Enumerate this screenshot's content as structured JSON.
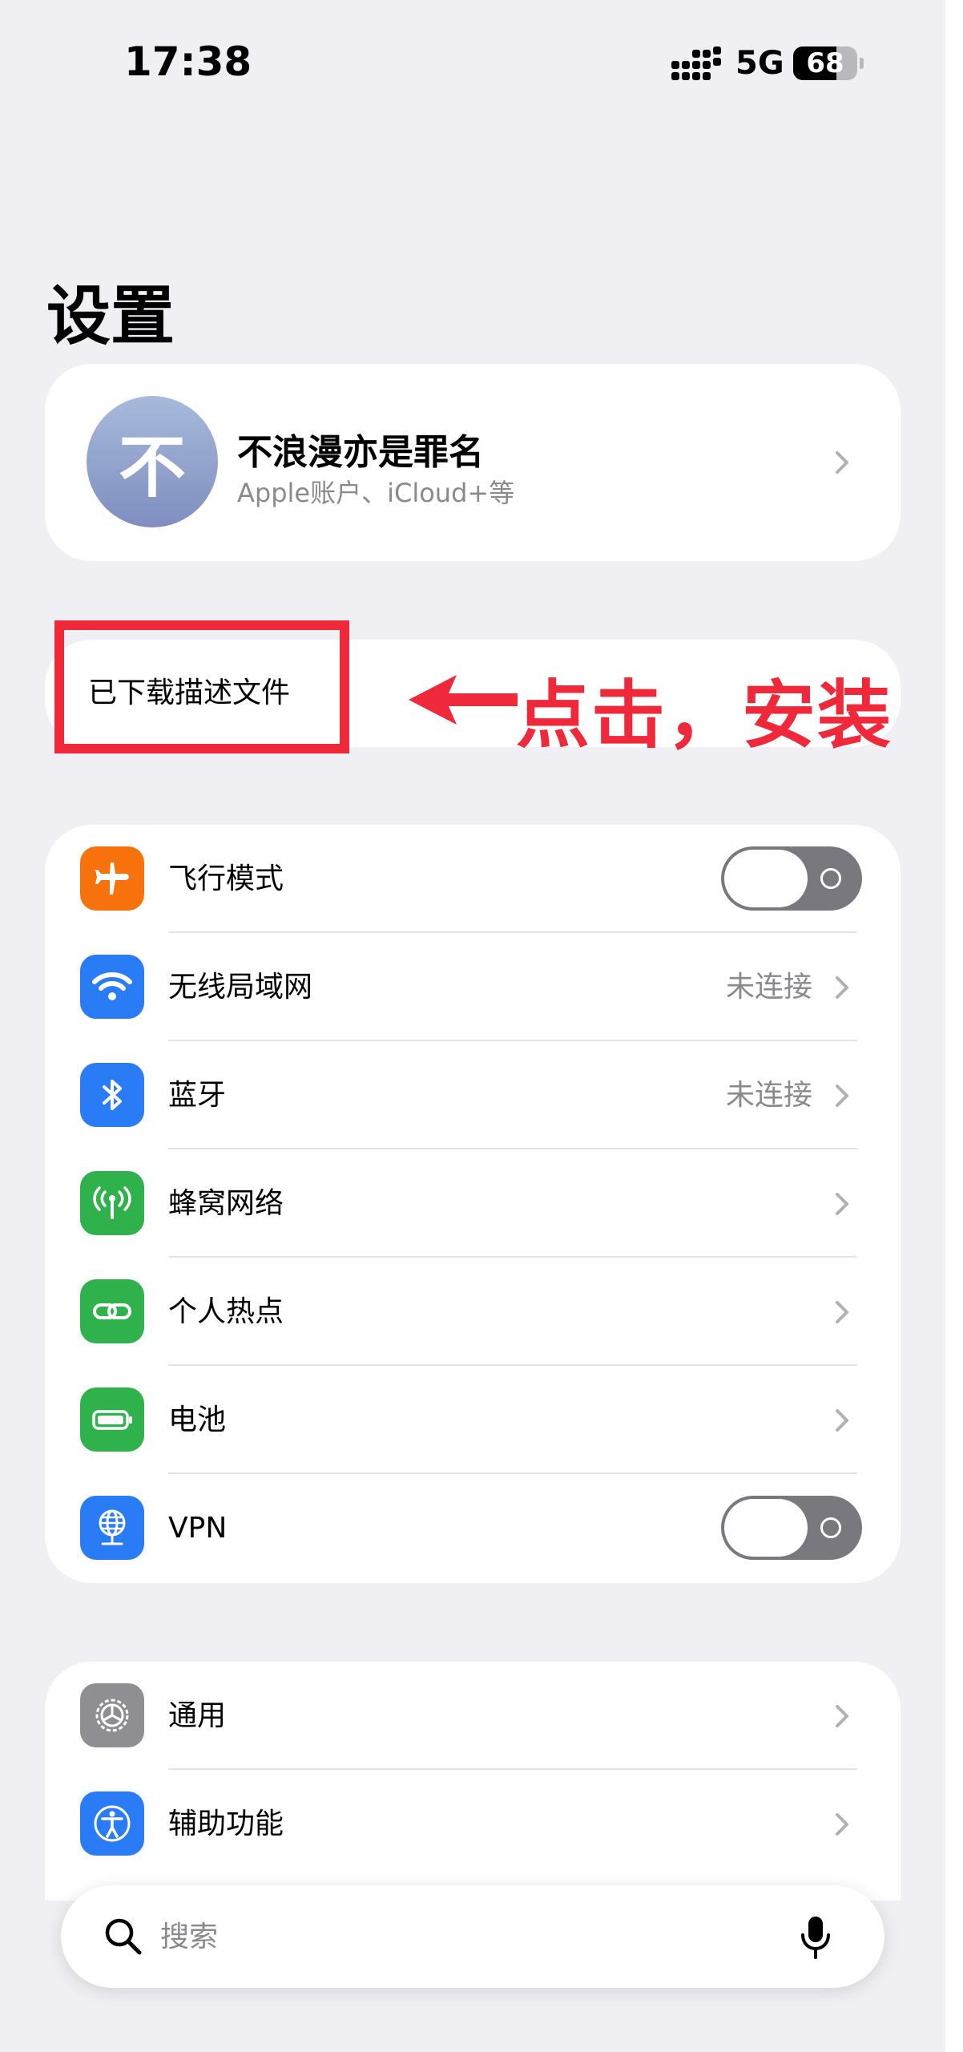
{
  "status_bar": {
    "time": "17:38",
    "network": "5G",
    "battery_level": 68,
    "battery_text": "68"
  },
  "page_title": "设置",
  "profile": {
    "avatar_char": "不",
    "name": "不浪漫亦是罪名",
    "subtitle": "Apple账户、iCloud+等"
  },
  "downloaded_profile": {
    "label": "已下载描述文件"
  },
  "annotation": {
    "text": "点击，安装",
    "color": "#f0293a"
  },
  "settings_group": [
    {
      "label": "飞行模式",
      "icon": "airplane-icon",
      "color": "#f7710d",
      "control": "toggle",
      "on": false
    },
    {
      "label": "无线局域网",
      "icon": "wifi-icon",
      "color": "#2a7cf6",
      "value": "未连接"
    },
    {
      "label": "蓝牙",
      "icon": "bluetooth-icon",
      "color": "#2a7cf6",
      "value": "未连接"
    },
    {
      "label": "蜂窝网络",
      "icon": "cellular-antenna-icon",
      "color": "#2fb24c"
    },
    {
      "label": "个人热点",
      "icon": "link-icon",
      "color": "#2fb24c"
    },
    {
      "label": "电池",
      "icon": "battery-icon",
      "color": "#2fb24c"
    },
    {
      "label": "VPN",
      "icon": "globe-network-icon",
      "color": "#2a7cf6",
      "control": "toggle",
      "on": false
    }
  ],
  "general_group": [
    {
      "label": "通用",
      "icon": "gear-icon",
      "color": "#8e8e93"
    },
    {
      "label": "辅助功能",
      "icon": "accessibility-icon",
      "color": "#2a7cf6"
    }
  ],
  "search": {
    "placeholder": "搜索"
  }
}
